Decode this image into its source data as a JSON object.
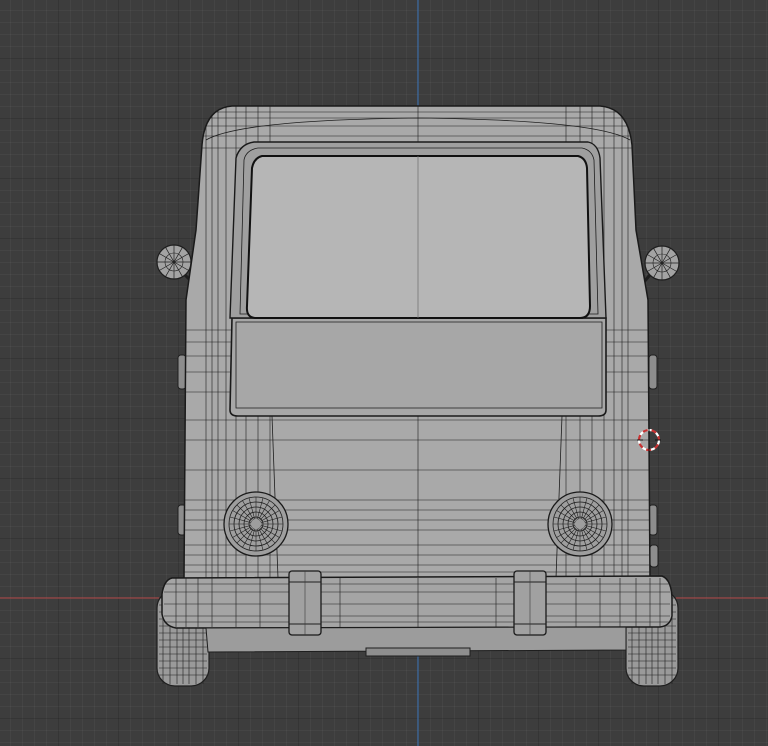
{
  "viewport": {
    "view": "front-orthographic",
    "shading": "solid-wireframe",
    "background_color": "#3d3d3d",
    "grid_color": "#303030",
    "x_axis_color": "#a04a4a",
    "z_axis_color": "#3f6fa8"
  },
  "model": {
    "object": "van-rear",
    "body_color": "#a9a9a9",
    "wire_color": "#1e1e1e",
    "window_color": "#b6b6b6"
  },
  "cursor": {
    "icon": "3d-cursor-icon",
    "ring_color": "#c83232"
  }
}
